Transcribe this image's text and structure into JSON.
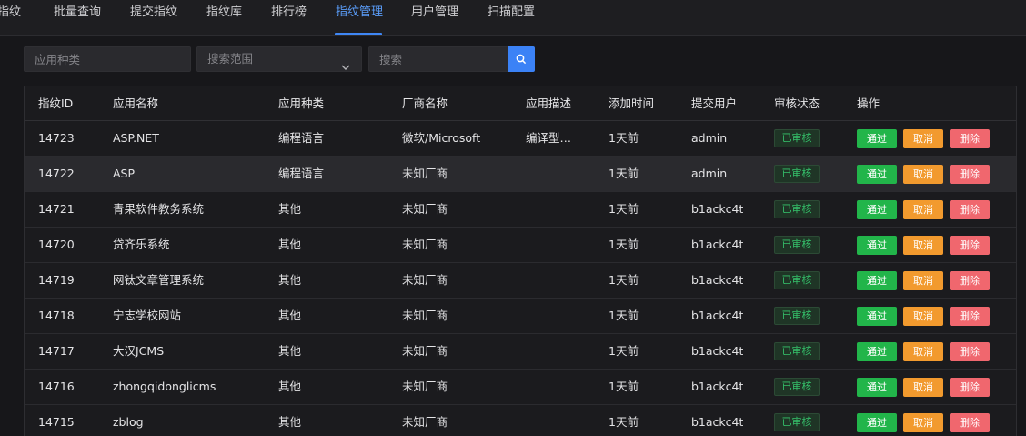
{
  "nav": {
    "items": [
      "指纹",
      "批量查询",
      "提交指纹",
      "指纹库",
      "排行榜",
      "指纹管理",
      "用户管理",
      "扫描配置"
    ],
    "active": "指纹管理"
  },
  "filters": {
    "category_placeholder": "应用种类",
    "scope_placeholder": "搜索范围",
    "search_placeholder": "搜索"
  },
  "table": {
    "headers": [
      "指纹ID",
      "应用名称",
      "应用种类",
      "厂商名称",
      "应用描述",
      "添加时间",
      "提交用户",
      "审核状态",
      "操作"
    ],
    "rows": [
      {
        "id": "14723",
        "name": "ASP.NET",
        "category": "编程语言",
        "vendor": "微软/Microsoft",
        "desc": "编译型…",
        "added": "1天前",
        "user": "admin",
        "status": "已审核"
      },
      {
        "id": "14722",
        "name": "ASP",
        "category": "编程语言",
        "vendor": "未知厂商",
        "desc": "",
        "added": "1天前",
        "user": "admin",
        "status": "已审核"
      },
      {
        "id": "14721",
        "name": "青果软件教务系统",
        "category": "其他",
        "vendor": "未知厂商",
        "desc": "",
        "added": "1天前",
        "user": "b1ackc4t",
        "status": "已审核"
      },
      {
        "id": "14720",
        "name": "贷齐乐系统",
        "category": "其他",
        "vendor": "未知厂商",
        "desc": "",
        "added": "1天前",
        "user": "b1ackc4t",
        "status": "已审核"
      },
      {
        "id": "14719",
        "name": "网钛文章管理系统",
        "category": "其他",
        "vendor": "未知厂商",
        "desc": "",
        "added": "1天前",
        "user": "b1ackc4t",
        "status": "已审核"
      },
      {
        "id": "14718",
        "name": "宁志学校网站",
        "category": "其他",
        "vendor": "未知厂商",
        "desc": "",
        "added": "1天前",
        "user": "b1ackc4t",
        "status": "已审核"
      },
      {
        "id": "14717",
        "name": "大汉JCMS",
        "category": "其他",
        "vendor": "未知厂商",
        "desc": "",
        "added": "1天前",
        "user": "b1ackc4t",
        "status": "已审核"
      },
      {
        "id": "14716",
        "name": "zhongqidonglicms",
        "category": "其他",
        "vendor": "未知厂商",
        "desc": "",
        "added": "1天前",
        "user": "b1ackc4t",
        "status": "已审核"
      },
      {
        "id": "14715",
        "name": "zblog",
        "category": "其他",
        "vendor": "未知厂商",
        "desc": "",
        "added": "1天前",
        "user": "b1ackc4t",
        "status": "已审核"
      }
    ],
    "actions": {
      "pass": "通过",
      "cancel": "取消",
      "delete": "删除"
    }
  },
  "colors": {
    "accent": "#3f87f5",
    "pass": "#22b54a",
    "cancel": "#f29a2e",
    "delete": "#f0676e",
    "status_text": "#35c26b"
  },
  "icons": {
    "search_button": "search-icon",
    "scope_dropdown": "chevron-down-icon"
  }
}
